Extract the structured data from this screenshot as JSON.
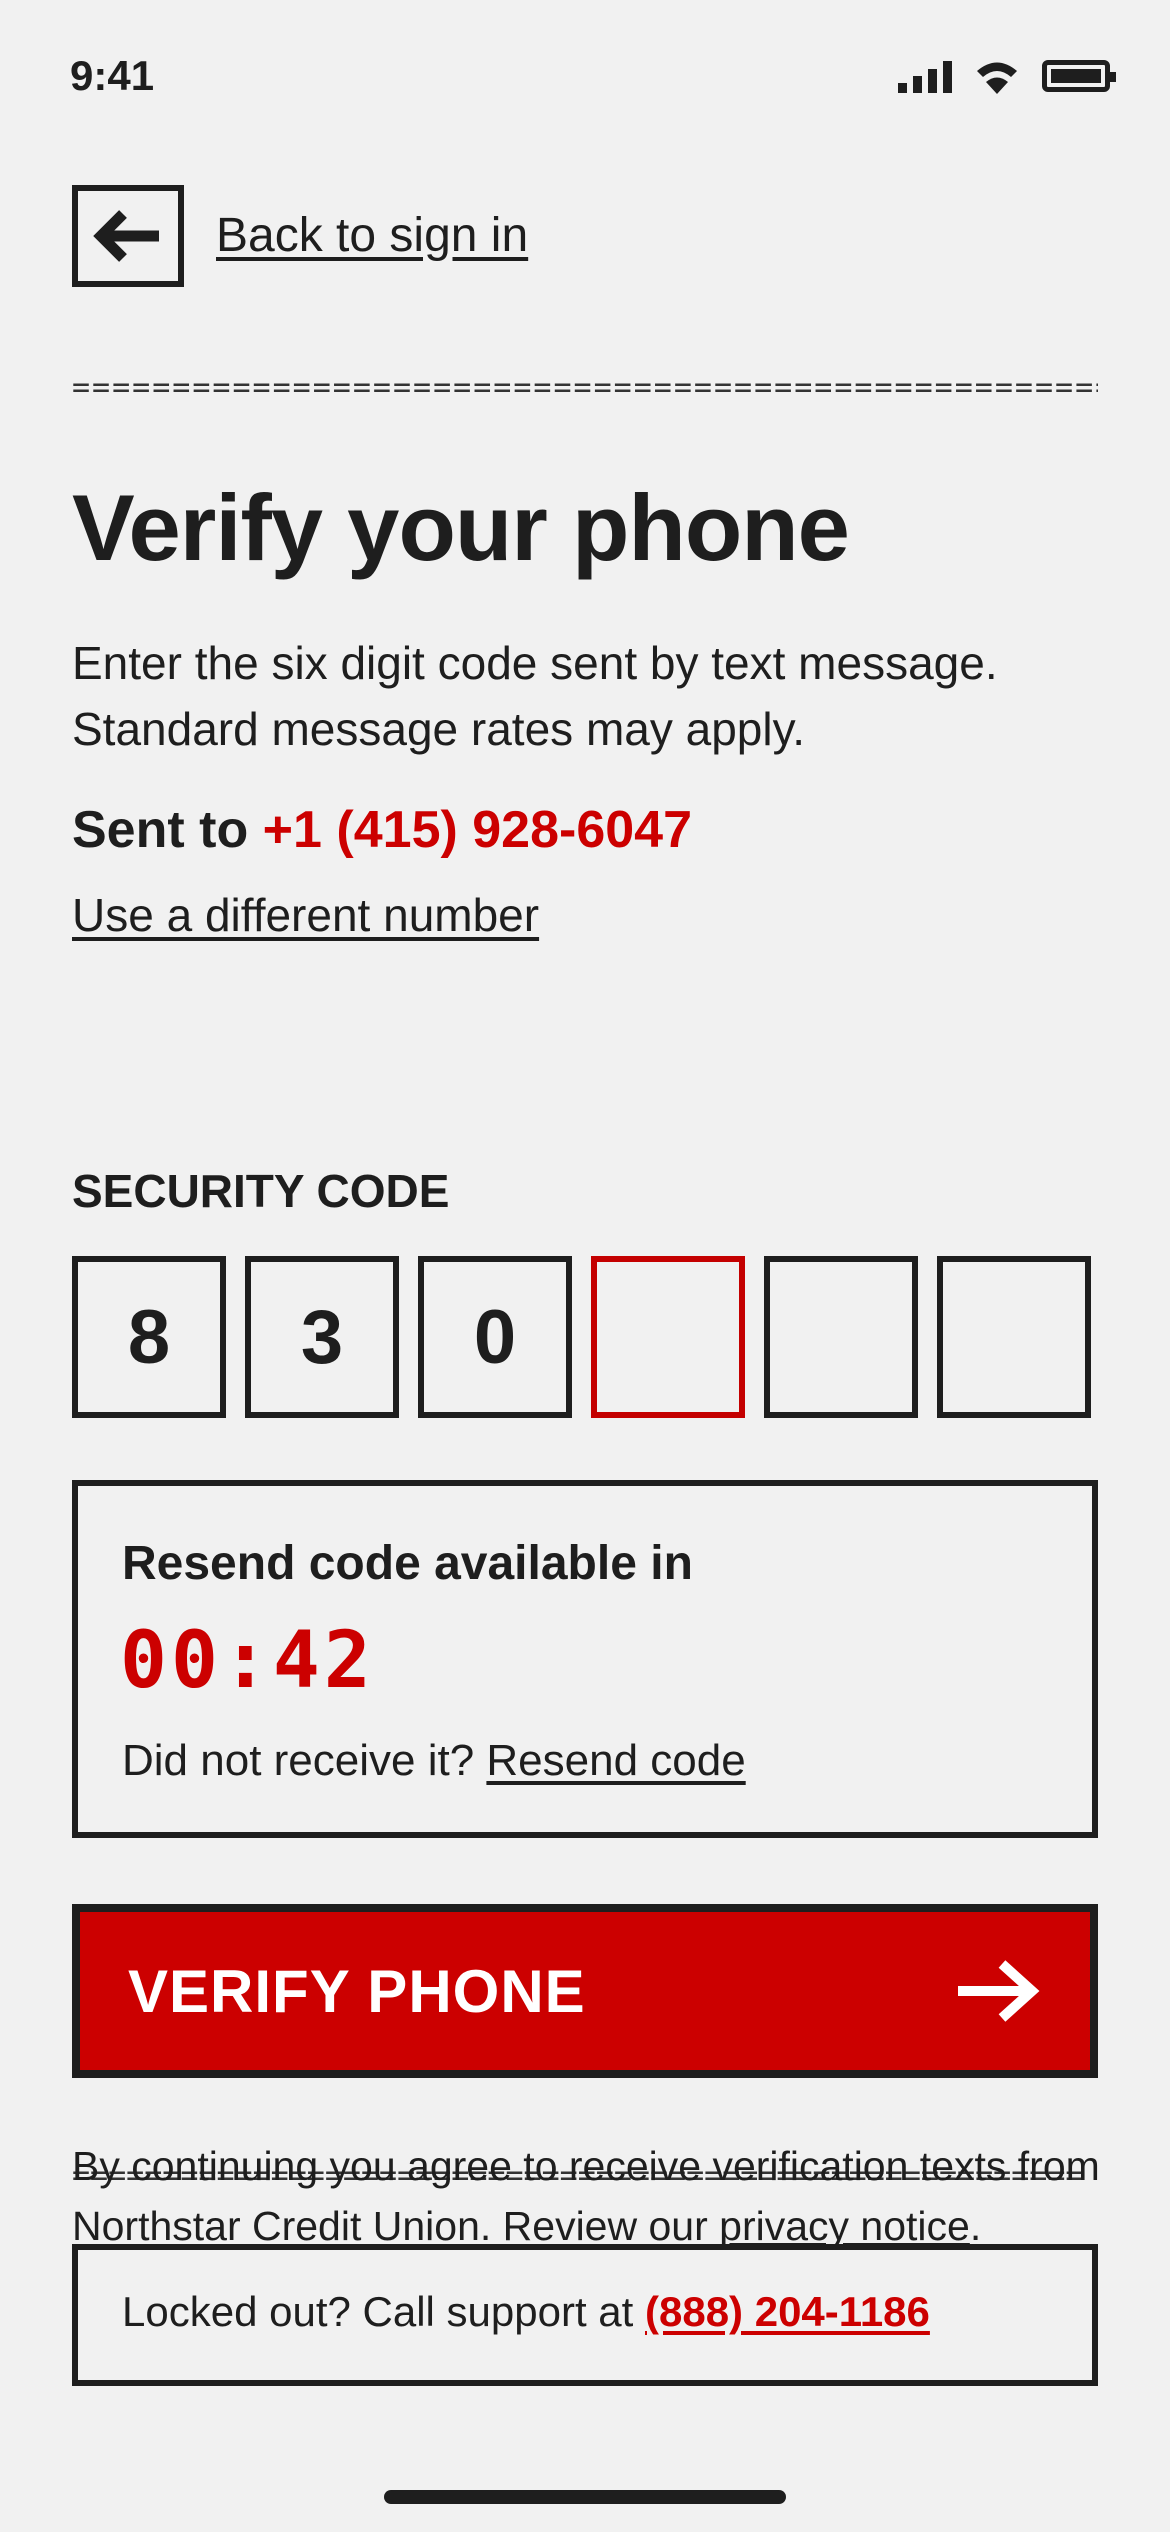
{
  "status_bar": {
    "time": "9:41"
  },
  "nav": {
    "back_label": "Back to sign in"
  },
  "rules": {
    "double": "========================================================",
    "dash": "______________________________________________________",
    "dash2": "========================================================"
  },
  "header": {
    "title": "Verify your phone",
    "description": "Enter the six digit code sent by text message. Standard message rates may apply.",
    "sent_prefix": "Sent to",
    "phone": "+1 (415) 928-6047",
    "different_number_link": "Use a different number"
  },
  "code": {
    "label": "SECURITY CODE",
    "digits": [
      "8",
      "3",
      "0",
      "",
      "",
      ""
    ],
    "active_index": 3
  },
  "resend": {
    "title": "Resend code available in",
    "timer": "00:42",
    "prompt": "Did not receive it?",
    "link": "Resend code"
  },
  "verify_button": {
    "label": "VERIFY PHONE"
  },
  "legal": {
    "text": "By continuing you agree to receive verification texts from Northstar Credit Union. Review our",
    "link": "privacy notice",
    "end": "."
  },
  "support": {
    "text": "Locked out? Call support at",
    "phone": "(888) 204-1186"
  },
  "colors": {
    "accent": "#cc0000",
    "ink": "#1e1e1e",
    "background": "#f1f1f1"
  }
}
